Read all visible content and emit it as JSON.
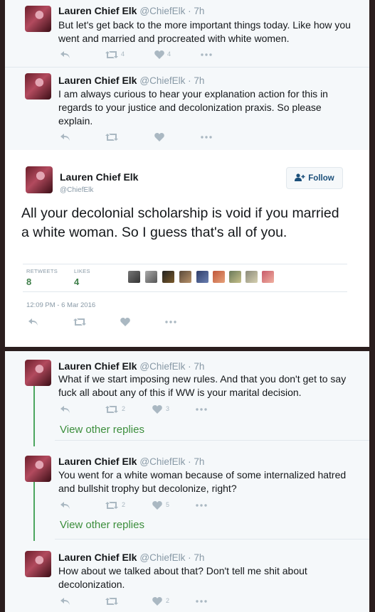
{
  "tweets_top": [
    {
      "name": "Lauren Chief Elk",
      "handle": "@ChiefElk · 7h",
      "text": "But let's get back to the more important things today. Like how you went and married and procreated with white women.",
      "retweets": "4",
      "likes": "4"
    },
    {
      "name": "Lauren Chief Elk",
      "handle": "@ChiefElk · 7h",
      "text": "I am always curious to hear your explanation action for this in regards to your justice and decolonization praxis. So please explain.",
      "retweets": "",
      "likes": ""
    }
  ],
  "main": {
    "name": "Lauren Chief Elk",
    "handle": "@ChiefElk",
    "follow_label": "Follow",
    "text": "All your decolonial scholarship is void if you married a white woman. So I guess that's all of you.",
    "retweets_label": "RETWEETS",
    "retweets": "8",
    "likes_label": "LIKES",
    "likes": "4",
    "timestamp": "12:09 PM - 6 Mar 2016"
  },
  "replies": [
    {
      "name": "Lauren Chief Elk",
      "handle": "@ChiefElk · 7h",
      "text": "What if we start imposing new rules. And that you don't get to say fuck all about any of this if WW is your marital decision.",
      "retweets": "2",
      "likes": "3",
      "more": "View other replies"
    },
    {
      "name": "Lauren Chief Elk",
      "handle": "@ChiefElk · 7h",
      "text": "You went for a white woman because of some internalized hatred and bullshit trophy but decolonize, right?",
      "retweets": "2",
      "likes": "5",
      "more": "View other replies"
    },
    {
      "name": "Lauren Chief Elk",
      "handle": "@ChiefElk · 7h",
      "text": "How about we talked about that? Don't tell me shit about decolonization.",
      "retweets": "",
      "likes": "2"
    }
  ],
  "colors": {
    "name_text": "#14171a",
    "handle_text": "#8899a6",
    "icon_gray": "#aab8c2",
    "thread_green": "#4ca65f",
    "stat_green": "#3f7f4a",
    "follow_text": "#1b4f7a"
  },
  "icons": [
    "reply-icon",
    "retweet-icon",
    "like-icon",
    "more-icon",
    "follow-person-icon"
  ]
}
